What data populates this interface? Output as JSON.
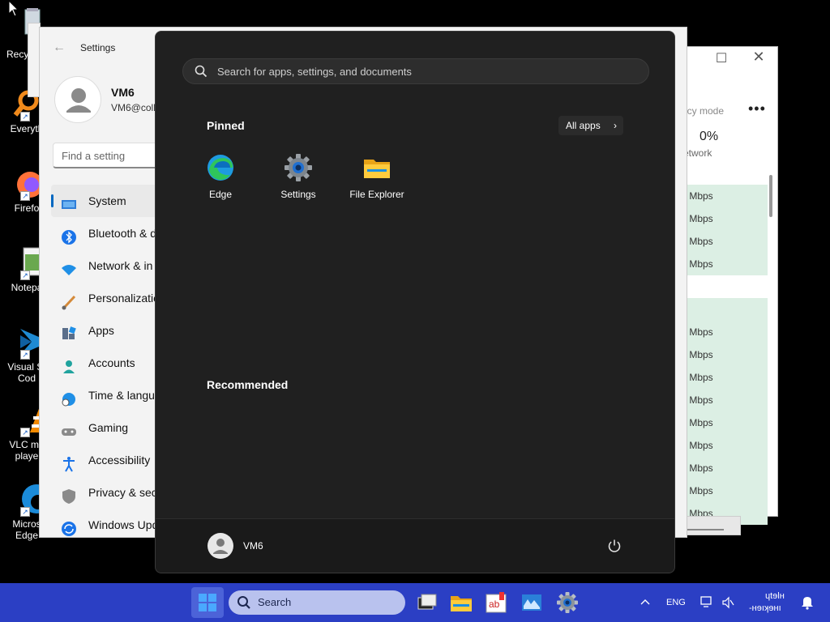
{
  "desktop": {
    "icons": [
      {
        "label": "Recy",
        "icon": "recycle-bin-icon"
      },
      {
        "label": "Everyth",
        "icon": "everything-search-icon"
      },
      {
        "label": "Firefo",
        "icon": "firefox-icon"
      },
      {
        "label": "Notepa",
        "icon": "notepad-icon"
      },
      {
        "label": "Visual St\nCod",
        "icon": "vscode-icon"
      },
      {
        "label": "VLC me\nplaye",
        "icon": "vlc-icon"
      },
      {
        "label": "Micros\nEdge",
        "icon": "edge-icon"
      }
    ]
  },
  "task_manager": {
    "efficiency_label": "ncy mode",
    "more_label": "•••",
    "network_percent": "0%",
    "network_label": "etwork",
    "rows": [
      {
        "text": "",
        "style": "blank"
      },
      {
        "text": ") Mbps",
        "style": "hl"
      },
      {
        "text": ") Mbps",
        "style": "hl"
      },
      {
        "text": ") Mbps",
        "style": "hl"
      },
      {
        "text": ") Mbps",
        "style": "hl"
      },
      {
        "text": "",
        "style": "gap"
      },
      {
        "text": "",
        "style": "hl"
      },
      {
        "text": ") Mbps",
        "style": "hl"
      },
      {
        "text": ") Mbps",
        "style": "hl"
      },
      {
        "text": ") Mbps",
        "style": "hl"
      },
      {
        "text": ") Mbps",
        "style": "hl"
      },
      {
        "text": ") Mbps",
        "style": "hl"
      },
      {
        "text": ") Mbps",
        "style": "hl"
      },
      {
        "text": ") Mbps",
        "style": "hl"
      },
      {
        "text": ") Mbps",
        "style": "hl"
      },
      {
        "text": ") Mbps",
        "style": "hl"
      }
    ]
  },
  "settings": {
    "title": "Settings",
    "user_name": "VM6",
    "user_email": "VM6@coll",
    "find_placeholder": "Find a setting",
    "nav": [
      {
        "label": "System",
        "icon": "monitor-icon",
        "selected": true
      },
      {
        "label": "Bluetooth & d",
        "icon": "bluetooth-icon"
      },
      {
        "label": "Network & in",
        "icon": "wifi-icon"
      },
      {
        "label": "Personalizatio",
        "icon": "brush-icon"
      },
      {
        "label": "Apps",
        "icon": "apps-icon"
      },
      {
        "label": "Accounts",
        "icon": "person-icon"
      },
      {
        "label": "Time & langu",
        "icon": "globe-clock-icon"
      },
      {
        "label": "Gaming",
        "icon": "gamepad-icon"
      },
      {
        "label": "Accessibility",
        "icon": "accessibility-icon"
      },
      {
        "label": "Privacy & secu",
        "icon": "shield-icon"
      },
      {
        "label": "Windows Upd",
        "icon": "update-icon"
      }
    ]
  },
  "start_menu": {
    "search_placeholder": "Search for apps, settings, and documents",
    "pinned_title": "Pinned",
    "all_apps_label": "All apps",
    "pinned": [
      {
        "label": "Edge",
        "icon": "edge-icon"
      },
      {
        "label": "Settings",
        "icon": "gear-icon"
      },
      {
        "label": "File Explorer",
        "icon": "folder-icon"
      }
    ],
    "recommended_title": "Recommended",
    "user_name": "VM6"
  },
  "taskbar": {
    "search_label": "Search",
    "language": "ENG",
    "clock_time": "ɥtɘlʜ",
    "clock_date": "-ʜɘıʞɘʜı"
  },
  "colors": {
    "taskbar": "#2b3fc4",
    "start_bg": "#202020",
    "accent": "#0067c0"
  }
}
